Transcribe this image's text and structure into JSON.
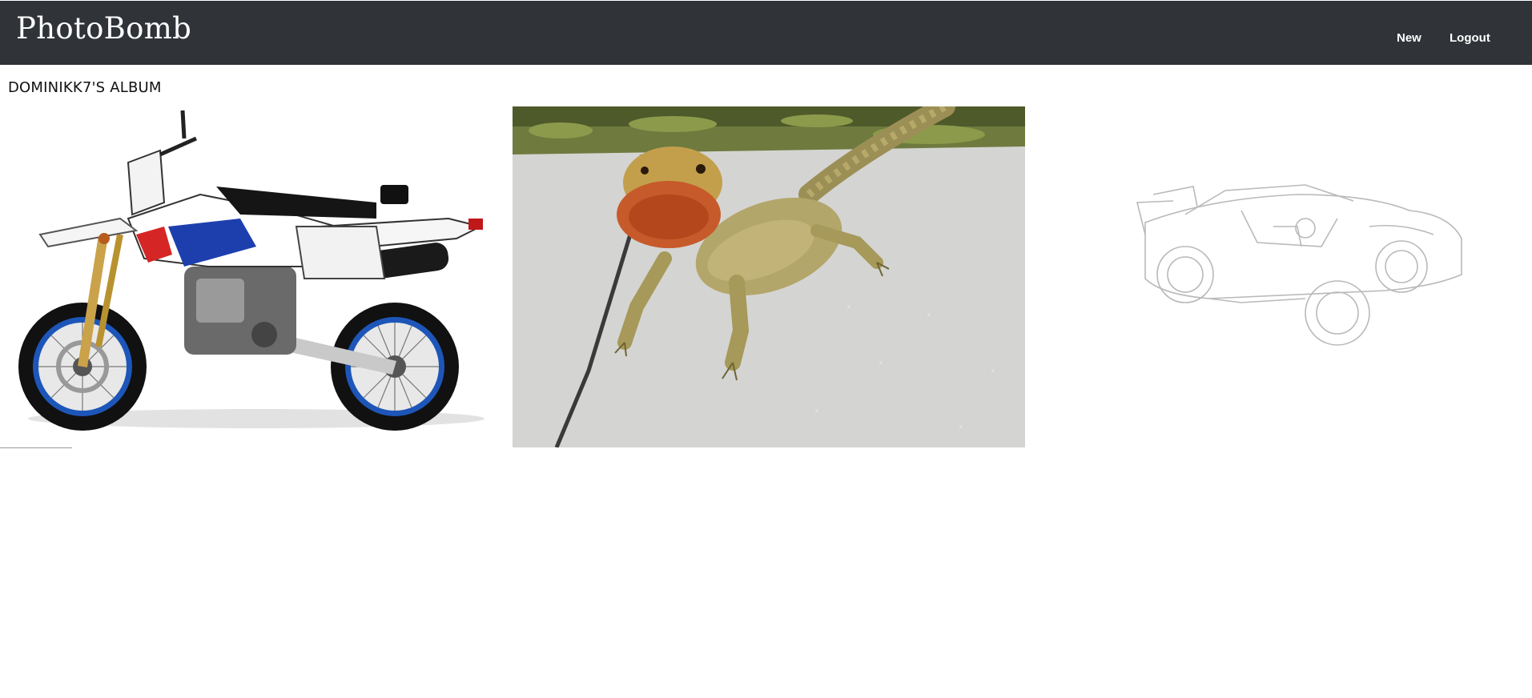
{
  "navbar": {
    "brand": "PhotoBomb",
    "links": [
      {
        "label": "New"
      },
      {
        "label": "Logout"
      }
    ],
    "background_color": "#303338"
  },
  "album": {
    "title": "DOMINIKK7'S ALBUM",
    "photos": [
      {
        "subject": "white supermoto motorcycle with blue rims"
      },
      {
        "subject": "bearded dragon lizard on concrete"
      },
      {
        "subject": "wireframe sketch of a sports car"
      }
    ]
  }
}
